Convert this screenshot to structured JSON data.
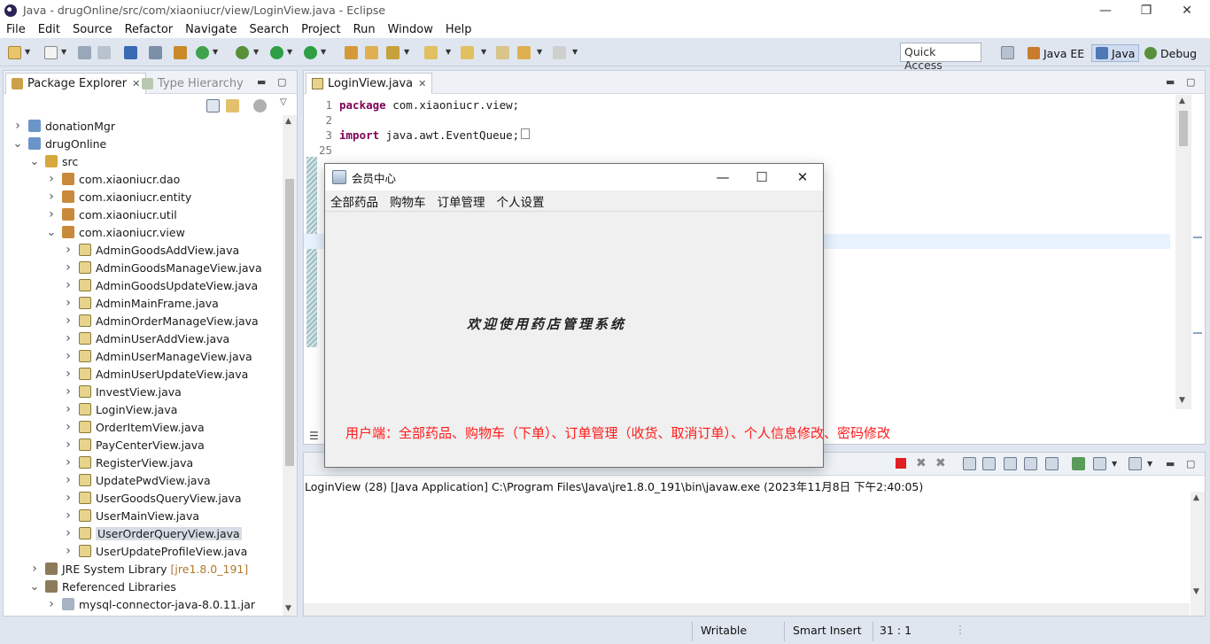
{
  "window": {
    "title": "Java - drugOnline/src/com/xiaoniucr/view/LoginView.java - Eclipse",
    "min": "—",
    "max": "❐",
    "close": "✕"
  },
  "menu": [
    "File",
    "Edit",
    "Source",
    "Refactor",
    "Navigate",
    "Search",
    "Project",
    "Run",
    "Window",
    "Help"
  ],
  "toolbar": {
    "quick_access": "Quick Access",
    "perspectives": [
      "Java EE",
      "Java",
      "Debug"
    ],
    "active_perspective": "Java"
  },
  "package_explorer": {
    "tabs": [
      "Package Explorer",
      "Type Hierarchy"
    ],
    "tree": [
      {
        "label": "donationMgr",
        "expanded": false,
        "icon": "project-icon"
      },
      {
        "label": "drugOnline",
        "expanded": true,
        "icon": "project-icon"
      },
      {
        "label": "src",
        "expanded": true,
        "icon": "source-folder-icon"
      },
      {
        "label": "com.xiaoniucr.dao",
        "expanded": false,
        "icon": "package-icon"
      },
      {
        "label": "com.xiaoniucr.entity",
        "expanded": false,
        "icon": "package-icon"
      },
      {
        "label": "com.xiaoniucr.util",
        "expanded": false,
        "icon": "package-icon"
      },
      {
        "label": "com.xiaoniucr.view",
        "expanded": true,
        "icon": "package-icon"
      },
      {
        "label": "AdminGoodsAddView.java",
        "icon": "java-file-icon"
      },
      {
        "label": "AdminGoodsManageView.java",
        "icon": "java-file-icon"
      },
      {
        "label": "AdminGoodsUpdateView.java",
        "icon": "java-file-icon"
      },
      {
        "label": "AdminMainFrame.java",
        "icon": "java-file-icon"
      },
      {
        "label": "AdminOrderManageView.java",
        "icon": "java-file-icon"
      },
      {
        "label": "AdminUserAddView.java",
        "icon": "java-file-icon"
      },
      {
        "label": "AdminUserManageView.java",
        "icon": "java-file-icon"
      },
      {
        "label": "AdminUserUpdateView.java",
        "icon": "java-file-icon"
      },
      {
        "label": "InvestView.java",
        "icon": "java-file-icon"
      },
      {
        "label": "LoginView.java",
        "icon": "java-file-icon"
      },
      {
        "label": "OrderItemView.java",
        "icon": "java-file-icon"
      },
      {
        "label": "PayCenterView.java",
        "icon": "java-file-icon"
      },
      {
        "label": "RegisterView.java",
        "icon": "java-file-icon"
      },
      {
        "label": "UpdatePwdView.java",
        "icon": "java-file-icon"
      },
      {
        "label": "UserGoodsQueryView.java",
        "icon": "java-file-icon"
      },
      {
        "label": "UserMainView.java",
        "icon": "java-file-icon"
      },
      {
        "label": "UserOrderQueryView.java",
        "icon": "java-file-icon",
        "selected": true
      },
      {
        "label": "UserUpdateProfileView.java",
        "icon": "java-file-icon"
      },
      {
        "label": "JRE System Library",
        "suffix": "[jre1.8.0_191]",
        "expanded": false,
        "icon": "library-icon"
      },
      {
        "label": "Referenced Libraries",
        "expanded": true,
        "icon": "library-icon"
      },
      {
        "label": "mysql-connector-java-8.0.11.jar",
        "expanded": false,
        "icon": "jar-icon"
      }
    ]
  },
  "editor": {
    "tab": "LoginView.java",
    "lines": [
      {
        "num": "1",
        "kw": "package",
        "text": " com.xiaoniucr.view;"
      },
      {
        "num": "2",
        "kw": "",
        "text": ""
      },
      {
        "num": "3",
        "kw": "import",
        "text": " java.awt.EventQueue;"
      },
      {
        "num": "25",
        "kw": "",
        "text": ""
      }
    ]
  },
  "console": {
    "launch": "LoginView (28) [Java Application] C:\\Program Files\\Java\\jre1.8.0_191\\bin\\javaw.exe (2023年11月8日 下午2:40:05)"
  },
  "dialog": {
    "title": "会员中心",
    "menu": [
      "全部药品",
      "购物车",
      "订单管理",
      "个人设置"
    ],
    "welcome": "欢迎使用药店管理系统"
  },
  "annotation": "用户端：全部药品、购物车（下单）、订单管理（收货、取消订单）、个人信息修改、密码修改",
  "status": {
    "writable": "Writable",
    "insert_mode": "Smart Insert",
    "position": "31 : 1"
  },
  "colors": {
    "annotation": "#ff1a1a",
    "keyword": "#7f0055",
    "chrome": "#dfe6f0"
  }
}
